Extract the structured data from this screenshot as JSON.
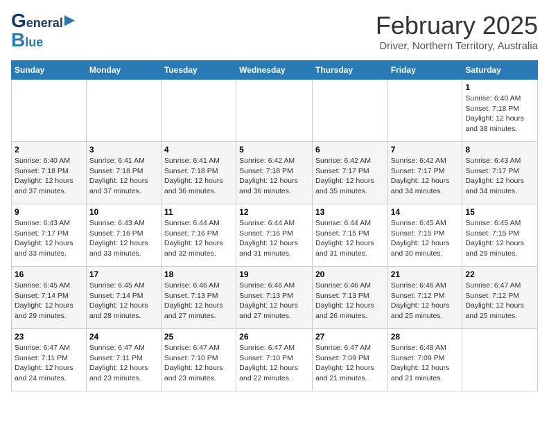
{
  "header": {
    "logo_general": "General",
    "logo_blue": "Blue",
    "title": "February 2025",
    "subtitle": "Driver, Northern Territory, Australia"
  },
  "days_of_week": [
    "Sunday",
    "Monday",
    "Tuesday",
    "Wednesday",
    "Thursday",
    "Friday",
    "Saturday"
  ],
  "weeks": [
    [
      {
        "day": "",
        "info": ""
      },
      {
        "day": "",
        "info": ""
      },
      {
        "day": "",
        "info": ""
      },
      {
        "day": "",
        "info": ""
      },
      {
        "day": "",
        "info": ""
      },
      {
        "day": "",
        "info": ""
      },
      {
        "day": "1",
        "info": "Sunrise: 6:40 AM\nSunset: 7:18 PM\nDaylight: 12 hours\nand 38 minutes."
      }
    ],
    [
      {
        "day": "2",
        "info": "Sunrise: 6:40 AM\nSunset: 7:18 PM\nDaylight: 12 hours\nand 37 minutes."
      },
      {
        "day": "3",
        "info": "Sunrise: 6:41 AM\nSunset: 7:18 PM\nDaylight: 12 hours\nand 37 minutes."
      },
      {
        "day": "4",
        "info": "Sunrise: 6:41 AM\nSunset: 7:18 PM\nDaylight: 12 hours\nand 36 minutes."
      },
      {
        "day": "5",
        "info": "Sunrise: 6:42 AM\nSunset: 7:18 PM\nDaylight: 12 hours\nand 36 minutes."
      },
      {
        "day": "6",
        "info": "Sunrise: 6:42 AM\nSunset: 7:17 PM\nDaylight: 12 hours\nand 35 minutes."
      },
      {
        "day": "7",
        "info": "Sunrise: 6:42 AM\nSunset: 7:17 PM\nDaylight: 12 hours\nand 34 minutes."
      },
      {
        "day": "8",
        "info": "Sunrise: 6:43 AM\nSunset: 7:17 PM\nDaylight: 12 hours\nand 34 minutes."
      }
    ],
    [
      {
        "day": "9",
        "info": "Sunrise: 6:43 AM\nSunset: 7:17 PM\nDaylight: 12 hours\nand 33 minutes."
      },
      {
        "day": "10",
        "info": "Sunrise: 6:43 AM\nSunset: 7:16 PM\nDaylight: 12 hours\nand 33 minutes."
      },
      {
        "day": "11",
        "info": "Sunrise: 6:44 AM\nSunset: 7:16 PM\nDaylight: 12 hours\nand 32 minutes."
      },
      {
        "day": "12",
        "info": "Sunrise: 6:44 AM\nSunset: 7:16 PM\nDaylight: 12 hours\nand 31 minutes."
      },
      {
        "day": "13",
        "info": "Sunrise: 6:44 AM\nSunset: 7:15 PM\nDaylight: 12 hours\nand 31 minutes."
      },
      {
        "day": "14",
        "info": "Sunrise: 6:45 AM\nSunset: 7:15 PM\nDaylight: 12 hours\nand 30 minutes."
      },
      {
        "day": "15",
        "info": "Sunrise: 6:45 AM\nSunset: 7:15 PM\nDaylight: 12 hours\nand 29 minutes."
      }
    ],
    [
      {
        "day": "16",
        "info": "Sunrise: 6:45 AM\nSunset: 7:14 PM\nDaylight: 12 hours\nand 29 minutes."
      },
      {
        "day": "17",
        "info": "Sunrise: 6:45 AM\nSunset: 7:14 PM\nDaylight: 12 hours\nand 28 minutes."
      },
      {
        "day": "18",
        "info": "Sunrise: 6:46 AM\nSunset: 7:13 PM\nDaylight: 12 hours\nand 27 minutes."
      },
      {
        "day": "19",
        "info": "Sunrise: 6:46 AM\nSunset: 7:13 PM\nDaylight: 12 hours\nand 27 minutes."
      },
      {
        "day": "20",
        "info": "Sunrise: 6:46 AM\nSunset: 7:13 PM\nDaylight: 12 hours\nand 26 minutes."
      },
      {
        "day": "21",
        "info": "Sunrise: 6:46 AM\nSunset: 7:12 PM\nDaylight: 12 hours\nand 25 minutes."
      },
      {
        "day": "22",
        "info": "Sunrise: 6:47 AM\nSunset: 7:12 PM\nDaylight: 12 hours\nand 25 minutes."
      }
    ],
    [
      {
        "day": "23",
        "info": "Sunrise: 6:47 AM\nSunset: 7:11 PM\nDaylight: 12 hours\nand 24 minutes."
      },
      {
        "day": "24",
        "info": "Sunrise: 6:47 AM\nSunset: 7:11 PM\nDaylight: 12 hours\nand 23 minutes."
      },
      {
        "day": "25",
        "info": "Sunrise: 6:47 AM\nSunset: 7:10 PM\nDaylight: 12 hours\nand 23 minutes."
      },
      {
        "day": "26",
        "info": "Sunrise: 6:47 AM\nSunset: 7:10 PM\nDaylight: 12 hours\nand 22 minutes."
      },
      {
        "day": "27",
        "info": "Sunrise: 6:47 AM\nSunset: 7:09 PM\nDaylight: 12 hours\nand 21 minutes."
      },
      {
        "day": "28",
        "info": "Sunrise: 6:48 AM\nSunset: 7:09 PM\nDaylight: 12 hours\nand 21 minutes."
      },
      {
        "day": "",
        "info": ""
      }
    ]
  ]
}
